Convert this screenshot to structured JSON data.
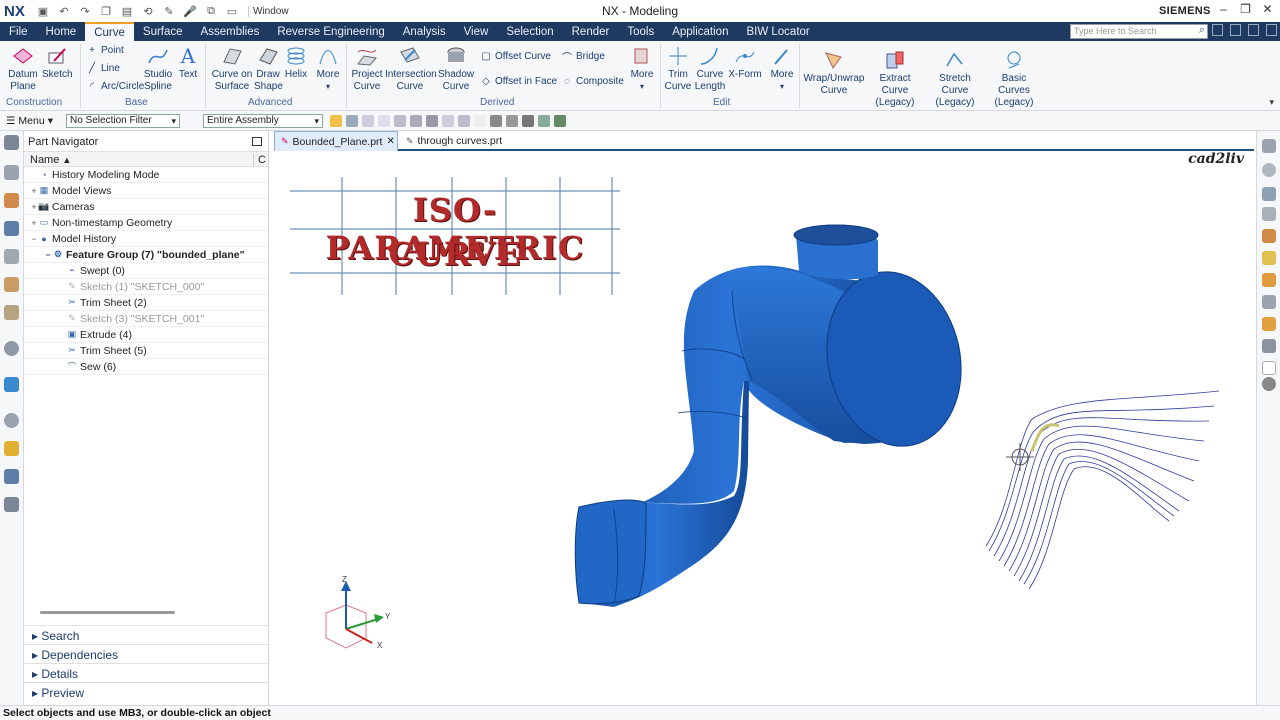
{
  "app": {
    "logo": "NX",
    "title": "NX - Modeling",
    "brand": "SIEMENS",
    "window_label": "Window"
  },
  "menubar": {
    "tabs": [
      "File",
      "Home",
      "Curve",
      "Surface",
      "Assemblies",
      "Reverse Engineering",
      "Analysis",
      "View",
      "Selection",
      "Render",
      "Tools",
      "Application",
      "BIW Locator"
    ],
    "active": "Curve",
    "search_placeholder": "Type Here to Search"
  },
  "ribbon": {
    "datum_plane": "Datum Plane",
    "sketch": "Sketch",
    "point": "Point",
    "line": "Line",
    "arc_circle": "Arc/Circle",
    "studio_spline": "Studio Spline",
    "text": "Text",
    "curve_on_surface": "Curve on Surface",
    "draw_shape": "Draw Shape",
    "helix": "Helix",
    "more": "More",
    "project_curve": "Project Curve",
    "intersection_curve": "Intersection Curve",
    "shadow_curve": "Shadow Curve",
    "offset_curve": "Offset Curve",
    "offset_in_face": "Offset in Face",
    "bridge": "Bridge",
    "composite": "Composite",
    "trim_curve": "Trim Curve",
    "curve_length": "Curve Length",
    "x_form": "X-Form",
    "wrap_unwrap": "Wrap/Unwrap Curve",
    "extract_curve": "Extract Curve (Legacy)",
    "stretch_curve": "Stretch Curve (Legacy)",
    "basic_curves": "Basic Curves (Legacy)",
    "groups": {
      "construction": "Construction",
      "base": "Base",
      "advanced": "Advanced",
      "derived": "Derived",
      "edit": "Edit"
    }
  },
  "toolbar": {
    "menu": "Menu",
    "selection_filter": "No Selection Filter",
    "scope": "Entire Assembly"
  },
  "navigator": {
    "title": "Part Navigator",
    "col_name": "Name",
    "col_c": "C",
    "rows": [
      {
        "label": "History Modeling Mode",
        "depth": 0,
        "exp": "",
        "state": "normal"
      },
      {
        "label": "Model Views",
        "depth": 0,
        "exp": "+",
        "state": "normal"
      },
      {
        "label": "Cameras",
        "depth": 0,
        "exp": "+",
        "state": "normal"
      },
      {
        "label": "Non-timestamp Geometry",
        "depth": 0,
        "exp": "+",
        "state": "normal"
      },
      {
        "label": "Model History",
        "depth": 0,
        "exp": "−",
        "state": "normal"
      },
      {
        "label": "Feature Group (7) \"bounded_plane\"",
        "depth": 1,
        "exp": "−",
        "state": "bold"
      },
      {
        "label": "Swept (0)",
        "depth": 2,
        "exp": "",
        "state": "normal"
      },
      {
        "label": "Sketch (1) \"SKETCH_000\"",
        "depth": 2,
        "exp": "",
        "state": "dim"
      },
      {
        "label": "Trim Sheet (2)",
        "depth": 2,
        "exp": "",
        "state": "normal"
      },
      {
        "label": "Sketch (3) \"SKETCH_001\"",
        "depth": 2,
        "exp": "",
        "state": "dim"
      },
      {
        "label": "Extrude (4)",
        "depth": 2,
        "exp": "",
        "state": "normal"
      },
      {
        "label": "Trim Sheet (5)",
        "depth": 2,
        "exp": "",
        "state": "normal"
      },
      {
        "label": "Sew (6)",
        "depth": 2,
        "exp": "",
        "state": "normal"
      }
    ],
    "sections": [
      "Search",
      "Dependencies",
      "Details",
      "Preview"
    ]
  },
  "tabs": [
    {
      "label": "Bounded_Plane.prt",
      "active": true
    },
    {
      "label": "through curves.prt",
      "active": false
    }
  ],
  "viewport": {
    "watermark": "cad2liv",
    "banner_line1": "ISO-PARAMETRIC",
    "banner_line2": "CURVE",
    "axis_z": "Z",
    "axis_y": "Y",
    "axis_x": "X"
  },
  "status": "Select objects and use MB3, or double-click an object",
  "colors": {
    "menubar": "#1e3a60",
    "accent": "#f39c26",
    "model_blue": "#1f63c4",
    "banner_red": "#b22a2a"
  }
}
